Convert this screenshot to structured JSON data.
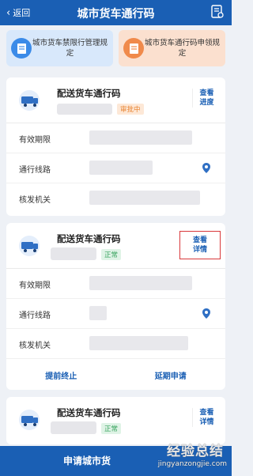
{
  "header": {
    "back_label": "返回",
    "title": "城市货车通行码",
    "right_icon": "document-list-icon"
  },
  "quick_links": [
    {
      "text": "城市货车禁限行管理规定",
      "icon": "document-icon",
      "color": "#3b8be8"
    },
    {
      "text": "城市货车通行码申领规定",
      "icon": "document-icon",
      "color": "#f08a4b"
    }
  ],
  "permits": [
    {
      "name": "配送货车通行码",
      "status": "审批中",
      "view_label_1": "查看",
      "view_label_2": "进度",
      "fields": [
        {
          "label": "有效期限"
        },
        {
          "label": "通行线路"
        },
        {
          "label": "核发机关"
        }
      ]
    },
    {
      "name": "配送货车通行码",
      "status": "正常",
      "view_label_1": "查看",
      "view_label_2": "详情",
      "fields": [
        {
          "label": "有效期限"
        },
        {
          "label": "通行线路"
        },
        {
          "label": "核发机关"
        }
      ],
      "actions": [
        "提前终止",
        "延期申请"
      ]
    },
    {
      "name": "配送货车通行码",
      "status": "正常",
      "view_label_1": "查看",
      "view_label_2": "详情"
    }
  ],
  "bottom_button": "申请城市货",
  "watermark": {
    "line1": "经验总结",
    "line2": "jingyanzongjie.com"
  },
  "colors": {
    "primary": "#1a5fb4",
    "review": "#e8822f",
    "ok": "#39a45f",
    "highlight": "#d9383a"
  }
}
